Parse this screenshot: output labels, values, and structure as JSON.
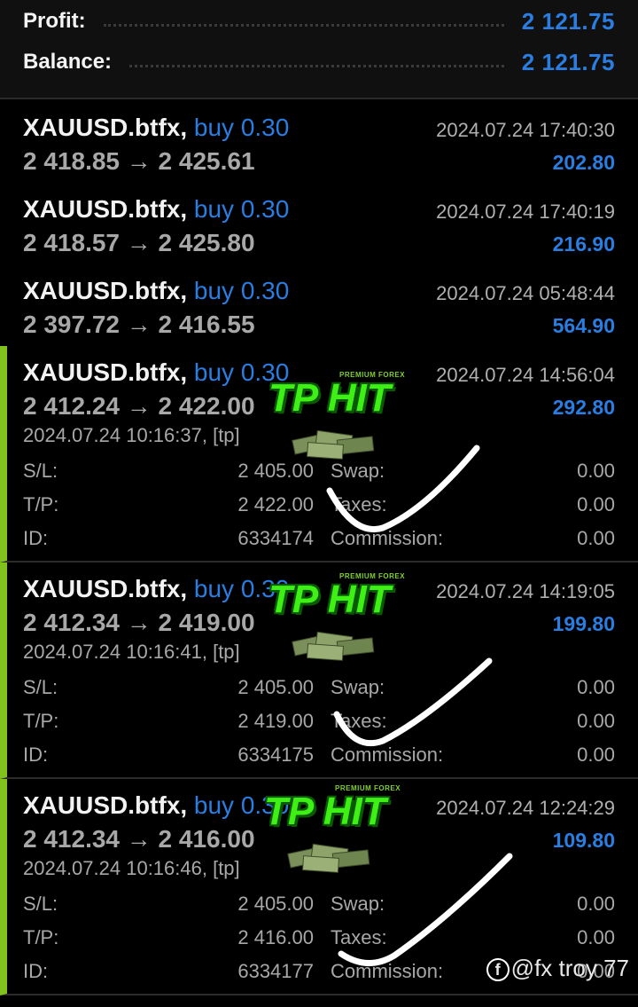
{
  "summary": {
    "profit_label": "Profit:",
    "profit_value": "2 121.75",
    "balance_label": "Balance:",
    "balance_value": "2 121.75"
  },
  "trades": [
    {
      "symbol": "XAUUSD.btfx,",
      "side": "buy 0.30",
      "prices": "2 418.85 → 2 425.61",
      "time": "2024.07.24 17:40:30",
      "profit": "202.80"
    },
    {
      "symbol": "XAUUSD.btfx,",
      "side": "buy 0.30",
      "prices": "2 418.57 → 2 425.80",
      "time": "2024.07.24 17:40:19",
      "profit": "216.90"
    },
    {
      "symbol": "XAUUSD.btfx,",
      "side": "buy 0.30",
      "prices": "2 397.72 → 2 416.55",
      "time": "2024.07.24 05:48:44",
      "profit": "564.90"
    },
    {
      "symbol": "XAUUSD.btfx,",
      "side": "buy 0.30",
      "prices": "2 412.24 → 2 422.00",
      "time": "2024.07.24 14:56:04",
      "profit": "292.80",
      "open_line": "2024.07.24 10:16:37, [tp]",
      "sl": "2 405.00",
      "tp": "2 422.00",
      "id": "6334174",
      "swap": "0.00",
      "taxes": "0.00",
      "commission": "0.00"
    },
    {
      "symbol": "XAUUSD.btfx,",
      "side": "buy 0.30",
      "prices": "2 412.34 → 2 419.00",
      "time": "2024.07.24 14:19:05",
      "profit": "199.80",
      "open_line": "2024.07.24 10:16:41, [tp]",
      "sl": "2 405.00",
      "tp": "2 419.00",
      "id": "6334175",
      "swap": "0.00",
      "taxes": "0.00",
      "commission": "0.00"
    },
    {
      "symbol": "XAUUSD.btfx,",
      "side": "buy 0.30",
      "prices": "2 412.34 → 2 416.00",
      "time": "2024.07.24 12:24:29",
      "profit": "109.80",
      "open_line": "2024.07.24 10:16:46, [tp]",
      "sl": "2 405.00",
      "tp": "2 416.00",
      "id": "6334177",
      "swap": "0.00",
      "taxes": "0.00",
      "commission": "0.00"
    }
  ],
  "labels": {
    "sl": "S/L:",
    "tp": "T/P:",
    "id": "ID:",
    "swap": "Swap:",
    "taxes": "Taxes:",
    "commission": "Commission:"
  },
  "overlay": {
    "premium": "PREMIUM FOREX",
    "tp_hit": "TP HIT"
  },
  "watermark": {
    "icon": "facebook-icon",
    "text": "@fx troy 77"
  },
  "colors": {
    "accent_blue": "#2a7de1",
    "tp_green": "#3ef016",
    "expanded_bar": "#7fc31c"
  }
}
